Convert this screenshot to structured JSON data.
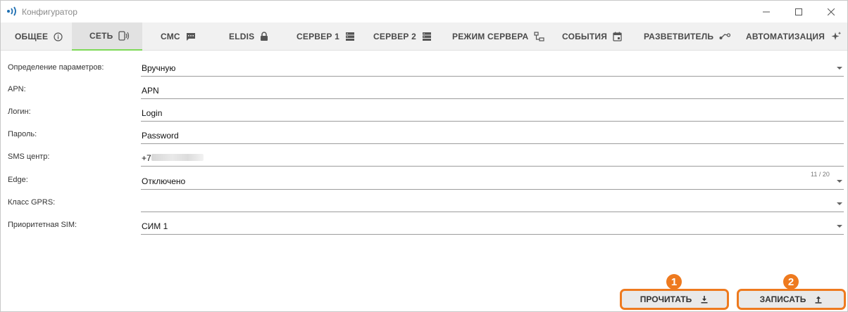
{
  "window": {
    "title": "Конфигуратор"
  },
  "tabs": [
    {
      "label": "ОБЩЕЕ",
      "icon": "info-icon"
    },
    {
      "label": "СЕТЬ",
      "icon": "phone-signal-icon",
      "active": true
    },
    {
      "label": "СМС",
      "icon": "message-icon"
    },
    {
      "label": "ELDIS",
      "icon": "lock-icon"
    },
    {
      "label": "СЕРВЕР 1",
      "icon": "server-icon"
    },
    {
      "label": "СЕРВЕР 2",
      "icon": "server-icon"
    },
    {
      "label": "РЕЖИМ СЕРВЕРА",
      "icon": "network-icon"
    },
    {
      "label": "СОБЫТИЯ",
      "icon": "calendar-icon"
    },
    {
      "label": "РАЗВЕТВИТЕЛЬ",
      "icon": "splitter-icon"
    },
    {
      "label": "АВТОМАТИЗАЦИЯ",
      "icon": "sparkle-icon"
    }
  ],
  "form": {
    "rows": [
      {
        "label": "Определение параметров:",
        "value": "Вручную",
        "type": "select"
      },
      {
        "label": "APN:",
        "value": "APN",
        "type": "text"
      },
      {
        "label": "Логин:",
        "value": "Login",
        "type": "text"
      },
      {
        "label": "Пароль:",
        "value": "Password",
        "type": "text"
      },
      {
        "label": "SMS центр:",
        "value": "+7",
        "type": "text",
        "counter": "11 / 20"
      },
      {
        "label": "Edge:",
        "value": "Отключено",
        "type": "select"
      },
      {
        "label": "Класс GPRS:",
        "value": "",
        "type": "select"
      },
      {
        "label": "Приоритетная SIM:",
        "value": "СИМ 1",
        "type": "select"
      }
    ]
  },
  "buttons": {
    "read_label": "ПРОЧИТАТЬ",
    "write_label": "ЗАПИСАТЬ",
    "read_badge": "1",
    "write_badge": "2"
  },
  "colors": {
    "accent": "#ee7a1f",
    "active_tab_underline": "#7ed957",
    "tab_bar": "#f1f1f1"
  }
}
